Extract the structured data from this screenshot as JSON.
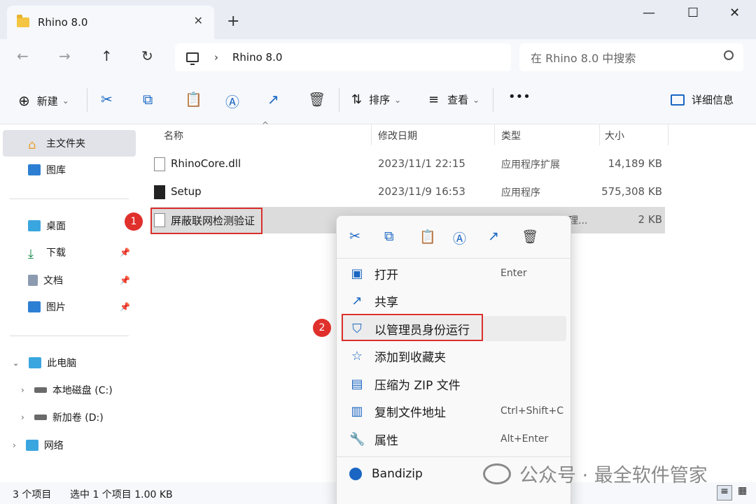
{
  "window": {
    "tab_title": "Rhino 8.0",
    "tab_close": "✕",
    "new_tab": "+",
    "minimize": "—",
    "maximize": "☐",
    "close": "✕"
  },
  "nav": {
    "back": "←",
    "forward": "→",
    "up": "↑",
    "refresh": "↻",
    "breadcrumb_sep": "›",
    "breadcrumb": "Rhino 8.0",
    "search_placeholder": "在 Rhino 8.0 中搜索"
  },
  "toolbar": {
    "new_icon": "⊕",
    "new_label": "新建",
    "new_arrow": "⌄",
    "sort_label": "排序",
    "sort_arrow": "⌄",
    "view_label": "查看",
    "view_arrow": "⌄",
    "more": "•••",
    "details_label": "详细信息"
  },
  "sidebar": {
    "items": [
      {
        "label": "主文件夹"
      },
      {
        "label": "图库"
      },
      {
        "label": "桌面"
      },
      {
        "label": "下载"
      },
      {
        "label": "文档"
      },
      {
        "label": "图片"
      },
      {
        "label": "此电脑"
      },
      {
        "label": "本地磁盘 (C:)"
      },
      {
        "label": "新加卷 (D:)"
      },
      {
        "label": "网络"
      }
    ]
  },
  "columns": {
    "name": "名称",
    "modified": "修改日期",
    "type": "类型",
    "size": "大小"
  },
  "files": [
    {
      "name": "RhinoCore.dll",
      "modified": "2023/11/1 22:15",
      "type": "应用程序扩展",
      "size": "14,189 KB"
    },
    {
      "name": "Setup",
      "modified": "2023/11/9 16:53",
      "type": "应用程序",
      "size": "575,308 KB"
    },
    {
      "name": "屏蔽联网检测验证",
      "modified": "",
      "type": "理...",
      "size": "2 KB"
    }
  ],
  "context_menu": {
    "items": [
      {
        "label": "打开",
        "shortcut": "Enter"
      },
      {
        "label": "共享",
        "shortcut": ""
      },
      {
        "label": "以管理员身份运行",
        "shortcut": ""
      },
      {
        "label": "添加到收藏夹",
        "shortcut": ""
      },
      {
        "label": "压缩为 ZIP 文件",
        "shortcut": ""
      },
      {
        "label": "复制文件地址",
        "shortcut": "Ctrl+Shift+C"
      },
      {
        "label": "属性",
        "shortcut": "Alt+Enter"
      },
      {
        "label": "Bandizip",
        "shortcut": ""
      }
    ]
  },
  "annotations": {
    "badge1": "1",
    "badge2": "2"
  },
  "status": {
    "count": "3 个项目",
    "selected": "选中 1 个项目  1.00 KB"
  },
  "watermark": "公众号 · 最全软件管家",
  "colors": {
    "accent": "#1a66c2",
    "highlight_red": "#d9302c",
    "selected_row": "#dcdcdc"
  }
}
